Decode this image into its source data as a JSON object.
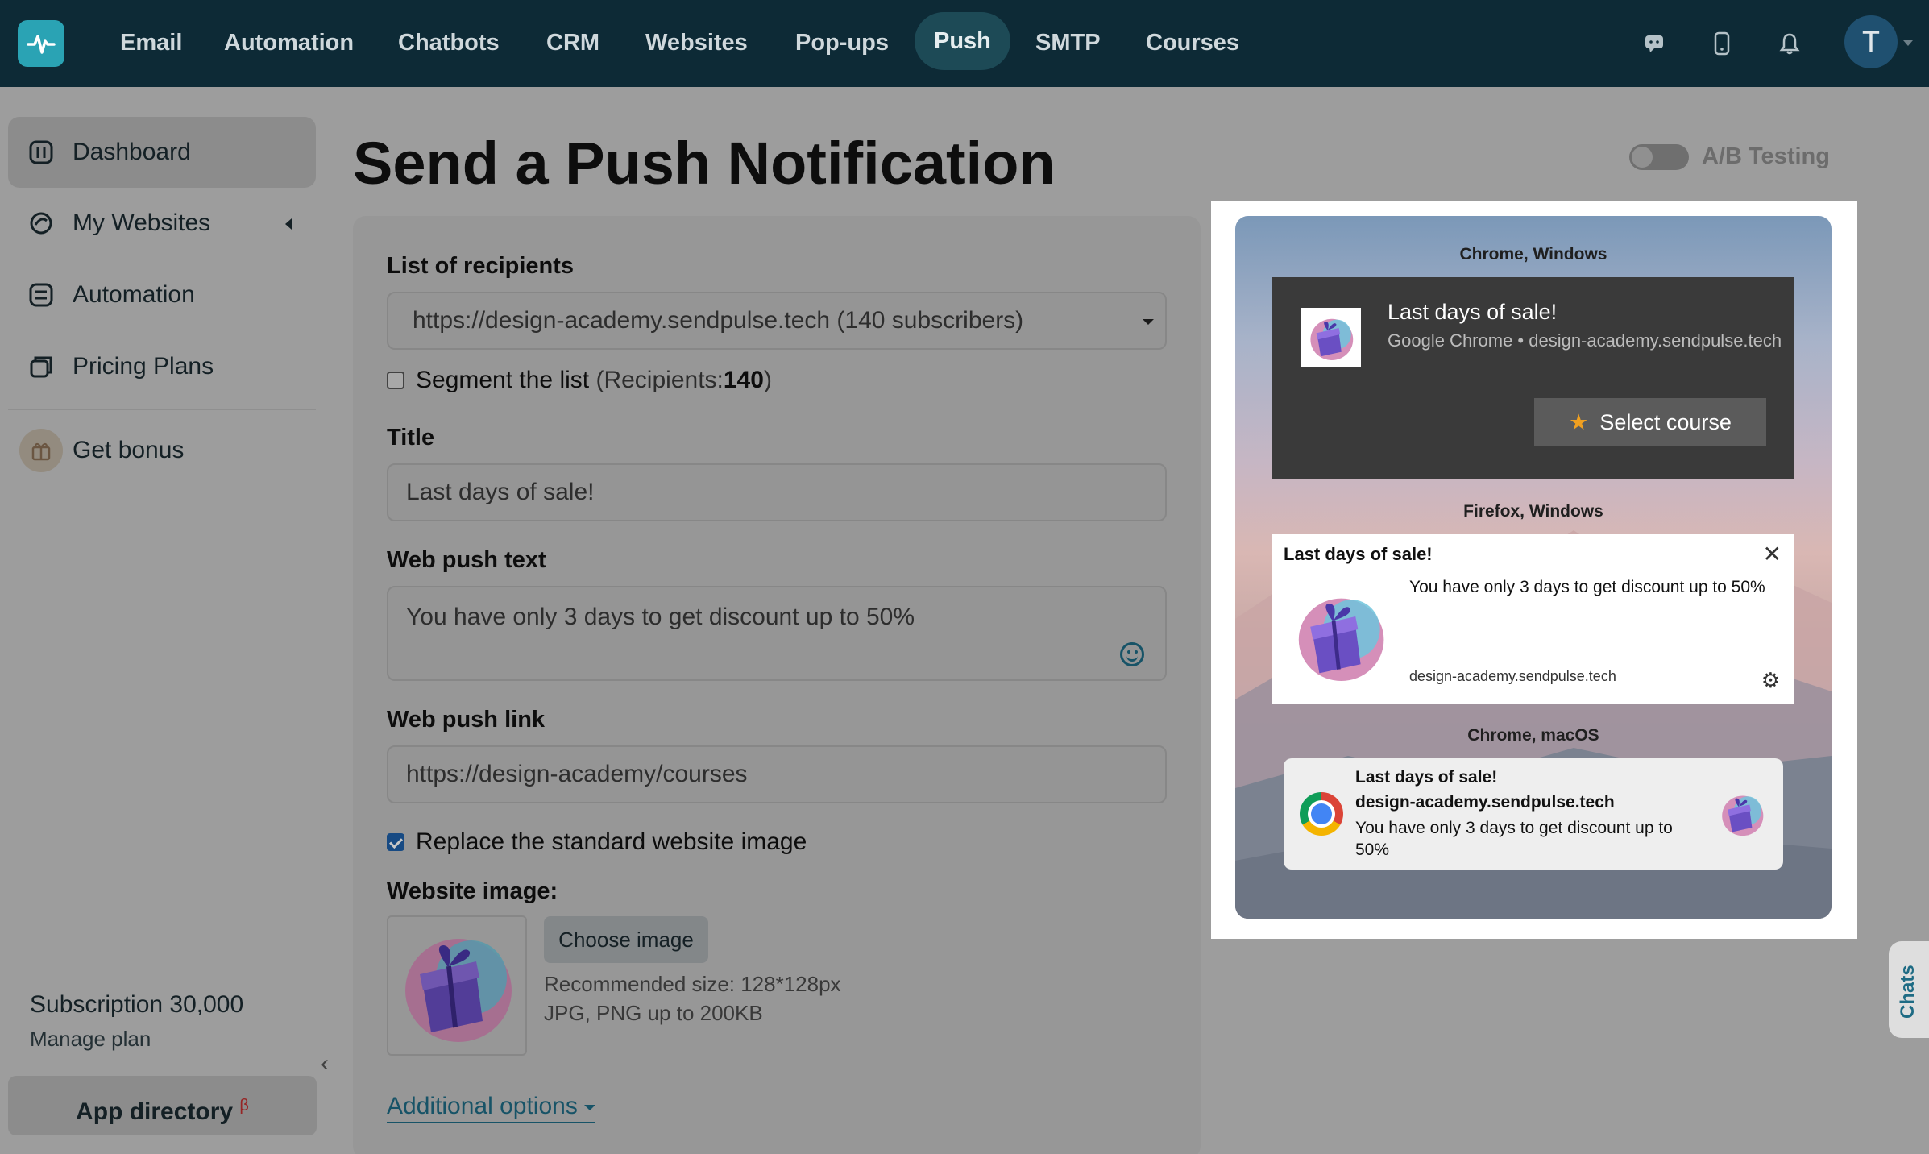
{
  "nav": {
    "items": [
      "Email",
      "Automation",
      "Chatbots",
      "CRM",
      "Websites",
      "Pop-ups",
      "Push",
      "SMTP",
      "Courses"
    ],
    "active": "Push",
    "avatar_letter": "T"
  },
  "sidebar": {
    "items": [
      {
        "label": "Dashboard",
        "icon": "dashboard-icon",
        "active": true
      },
      {
        "label": "My Websites",
        "icon": "websites-icon"
      },
      {
        "label": "Automation",
        "icon": "automation-icon"
      },
      {
        "label": "Pricing Plans",
        "icon": "pricing-icon"
      },
      {
        "label": "Get bonus",
        "icon": "gift-icon"
      }
    ],
    "subscription": "Subscription 30,000",
    "manage_plan": "Manage plan",
    "app_directory": "App directory",
    "app_directory_badge": "β"
  },
  "page": {
    "title": "Send a Push Notification",
    "ab_testing": "A/B Testing"
  },
  "form": {
    "recipients_label": "List of recipients",
    "recipients_value": "https://design-academy.sendpulse.tech (140 subscribers)",
    "segment_label": "Segment the list",
    "segment_prefix": "(Recipients: ",
    "segment_count": "140",
    "segment_suffix": ")",
    "title_label": "Title",
    "title_value": "Last days of sale!",
    "text_label": "Web push text",
    "text_value": "You have only 3 days to get discount up to 50%",
    "link_label": "Web push link",
    "link_value": "https://design-academy/courses",
    "replace_image_label": "Replace the standard website image",
    "website_image_label": "Website image:",
    "choose_image": "Choose image",
    "hint_size": "Recommended size: 128*128px",
    "hint_format": "JPG, PNG up to 200KB",
    "additional_options": "Additional options"
  },
  "preview": {
    "chrome_windows": {
      "heading": "Chrome, Windows",
      "title": "Last days of sale!",
      "subtitle": "Google Chrome • design-academy.sendpulse.tech",
      "button": "Select course"
    },
    "firefox_windows": {
      "heading": "Firefox, Windows",
      "title": "Last days of sale!",
      "body": "You have only 3 days to get discount up to 50%",
      "domain": "design-academy.sendpulse.tech"
    },
    "chrome_macos": {
      "heading": "Chrome, macOS",
      "title": "Last days of sale!",
      "domain": "design-academy.sendpulse.tech",
      "body": "You have only 3 days to get discount up to 50%"
    }
  },
  "chats_tab": "Chats",
  "colors": {
    "topbar": "#0d2a36",
    "accent": "#2aa3b4",
    "link": "#1e6b84"
  }
}
